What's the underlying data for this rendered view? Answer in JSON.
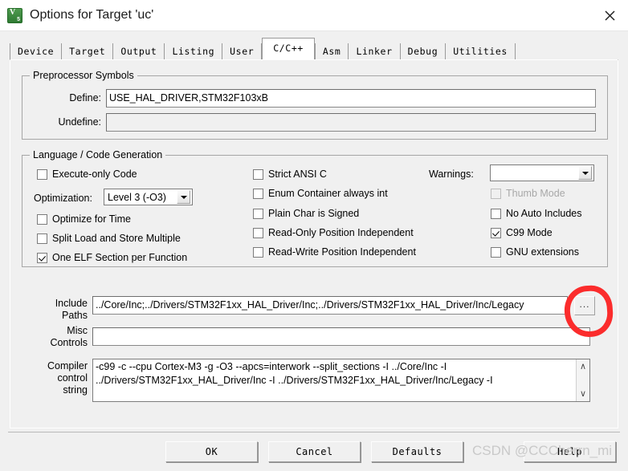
{
  "window": {
    "title": "Options for Target 'uc'",
    "icon": "keil-uvision-icon",
    "close_label": "✕"
  },
  "tabs": [
    {
      "label": "Device",
      "active": false
    },
    {
      "label": "Target",
      "active": false
    },
    {
      "label": "Output",
      "active": false
    },
    {
      "label": "Listing",
      "active": false
    },
    {
      "label": "User",
      "active": false
    },
    {
      "label": "C/C++",
      "active": true
    },
    {
      "label": "Asm",
      "active": false
    },
    {
      "label": "Linker",
      "active": false
    },
    {
      "label": "Debug",
      "active": false
    },
    {
      "label": "Utilities",
      "active": false
    }
  ],
  "preprocessor": {
    "legend": "Preprocessor Symbols",
    "define_label": "Define:",
    "define_value": "USE_HAL_DRIVER,STM32F103xB",
    "undefine_label": "Undefine:",
    "undefine_value": ""
  },
  "language": {
    "legend": "Language / Code Generation",
    "col1": [
      {
        "label": "Execute-only Code",
        "checked": false,
        "disabled": false
      },
      {
        "label": "Optimize for Time",
        "checked": false,
        "disabled": false
      },
      {
        "label": "Split Load and Store Multiple",
        "checked": false,
        "disabled": false
      },
      {
        "label": "One ELF Section per Function",
        "checked": true,
        "disabled": false
      }
    ],
    "optimization_label": "Optimization:",
    "optimization_value": "Level 3 (-O3)",
    "col2": [
      {
        "label": "Strict ANSI C",
        "checked": false,
        "disabled": false
      },
      {
        "label": "Enum Container always int",
        "checked": false,
        "disabled": false
      },
      {
        "label": "Plain Char is Signed",
        "checked": false,
        "disabled": false
      },
      {
        "label": "Read-Only Position Independent",
        "checked": false,
        "disabled": false
      },
      {
        "label": "Read-Write Position Independent",
        "checked": false,
        "disabled": false
      }
    ],
    "warnings_label": "Warnings:",
    "warnings_value": "",
    "col3": [
      {
        "label": "Thumb Mode",
        "checked": false,
        "disabled": true
      },
      {
        "label": "No Auto Includes",
        "checked": false,
        "disabled": false
      },
      {
        "label": "C99 Mode",
        "checked": true,
        "disabled": false
      },
      {
        "label": "GNU extensions",
        "checked": false,
        "disabled": false
      }
    ]
  },
  "paths": {
    "include_label_line1": "Include",
    "include_label_line2": "Paths",
    "include_value": "../Core/Inc;../Drivers/STM32F1xx_HAL_Driver/Inc;../Drivers/STM32F1xx_HAL_Driver/Inc/Legacy",
    "browse_label": "...",
    "misc_label_line1": "Misc",
    "misc_label_line2": "Controls",
    "misc_value": ""
  },
  "compiler": {
    "label_line1": "Compiler",
    "label_line2": "control",
    "label_line3": "string",
    "value": "-c99 -c --cpu Cortex-M3 -g -O3 --apcs=interwork --split_sections -I ../Core/Inc -I\n../Drivers/STM32F1xx_HAL_Driver/Inc -I ../Drivers/STM32F1xx_HAL_Driver/Inc/Legacy -I",
    "scroll_up": "∧",
    "scroll_down": "∨"
  },
  "buttons": {
    "ok": "OK",
    "cancel": "Cancel",
    "defaults": "Defaults",
    "help": "Help"
  },
  "annotation": {
    "circle_color": "#fb2c2c",
    "target": "browse-button"
  },
  "watermark": "CSDN @CCCherrn_mi"
}
